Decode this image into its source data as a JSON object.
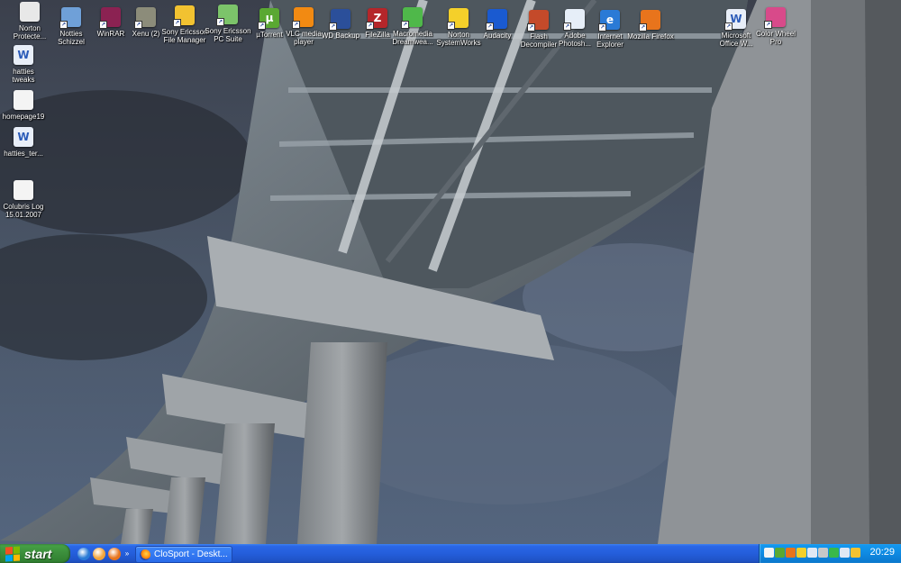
{
  "desktop": {
    "icons": [
      {
        "id": "norton-protected",
        "label": "Norton\nProtecte...",
        "glyph": "",
        "color": "#e8e8e8",
        "shortcut": false
      },
      {
        "id": "notties-schizzel",
        "label": "Notties\nSchizzel",
        "glyph": "",
        "color": "#6fa0d8",
        "shortcut": true
      },
      {
        "id": "winrar",
        "label": "WinRAR",
        "glyph": "",
        "color": "#8b2252",
        "shortcut": true
      },
      {
        "id": "xenu",
        "label": "Xenu (2)",
        "glyph": "",
        "color": "#8c8c7a",
        "shortcut": true
      },
      {
        "id": "sony-ericsson-file-manager",
        "label": "Sony Ericsson\nFile Manager",
        "glyph": "",
        "color": "#f2c231",
        "shortcut": true
      },
      {
        "id": "sony-ericsson-pc-suite",
        "label": "Sony Ericsson\nPC Suite",
        "glyph": "",
        "color": "#7cc46a",
        "shortcut": true
      },
      {
        "id": "utorrent",
        "label": "µTorrent",
        "glyph": "µ",
        "color": "#5aa832",
        "shortcut": true
      },
      {
        "id": "vlc",
        "label": "VLC media\nplayer",
        "glyph": "",
        "color": "#f28a12",
        "shortcut": true
      },
      {
        "id": "wd-backup",
        "label": "WD Backup",
        "glyph": "",
        "color": "#2b4f9a",
        "shortcut": true
      },
      {
        "id": "filezilla",
        "label": "FileZilla",
        "glyph": "Z",
        "color": "#b5262a",
        "shortcut": true
      },
      {
        "id": "dreamweaver",
        "label": "Macromedia\nDreamwea...",
        "glyph": "",
        "color": "#4fb84a",
        "shortcut": true
      },
      {
        "id": "norton-systemworks",
        "label": "Norton\nSystemWorks",
        "glyph": "",
        "color": "#f4d02a",
        "shortcut": true
      },
      {
        "id": "audacity",
        "label": "Audacity",
        "glyph": "",
        "color": "#1a5ad0",
        "shortcut": true
      },
      {
        "id": "flash-decompiler",
        "label": "Flash\nDecompiler",
        "glyph": "",
        "color": "#c44a2a",
        "shortcut": true
      },
      {
        "id": "adobe-photoshop",
        "label": "Adobe\nPhotosh...",
        "glyph": "",
        "color": "#e6eef8",
        "shortcut": true
      },
      {
        "id": "internet-explorer",
        "label": "Internet\nExplorer",
        "glyph": "e",
        "color": "#2a7ad6",
        "shortcut": true
      },
      {
        "id": "mozilla-firefox",
        "label": "Mozilla Firefox",
        "glyph": "",
        "color": "#e8741c",
        "shortcut": true
      },
      {
        "id": "microsoft-office-word",
        "label": "Microsoft\nOffice W...",
        "glyph": "W",
        "color": "#e8eef8",
        "shortcut": true
      },
      {
        "id": "color-wheel-pro",
        "label": "Color Wheel\nPro",
        "glyph": "",
        "color": "#d84a8a",
        "shortcut": true
      },
      {
        "id": "hatties-tweaks",
        "label": "hatties\ntweaks",
        "glyph": "W",
        "color": "#e8eef8",
        "shortcut": false
      },
      {
        "id": "homepage19",
        "label": "homepage19",
        "glyph": "",
        "color": "#f4f4f4",
        "shortcut": false
      },
      {
        "id": "hatties-ter",
        "label": "hatties_ter...",
        "glyph": "W",
        "color": "#e8eef8",
        "shortcut": false
      },
      {
        "id": "colubris-log",
        "label": "Colubris Log\n15.01.2007",
        "glyph": "",
        "color": "#f4f4f4",
        "shortcut": false
      }
    ]
  },
  "taskbar": {
    "start_label": "start",
    "quick_launch": [
      {
        "id": "ql-ie",
        "color": "#2a7ad6"
      },
      {
        "id": "ql-desktop",
        "color": "#f2a43a"
      },
      {
        "id": "ql-firefox",
        "color": "#e8741c"
      }
    ],
    "quick_launch_more": "»",
    "task_button_label": "CloSport - Deskt...",
    "tray_icons": [
      {
        "id": "tray-icon-1",
        "color": "#f4f4f4"
      },
      {
        "id": "tray-icon-2",
        "color": "#5aa832"
      },
      {
        "id": "tray-icon-3",
        "color": "#e8741c"
      },
      {
        "id": "tray-icon-4",
        "color": "#f4d02a"
      },
      {
        "id": "tray-icon-5",
        "color": "#dfe8f4"
      },
      {
        "id": "tray-icon-6",
        "color": "#c8c8c8"
      },
      {
        "id": "tray-icon-7",
        "color": "#3ab84a"
      },
      {
        "id": "tray-icon-8",
        "color": "#dfe8f4"
      },
      {
        "id": "tray-icon-9",
        "color": "#f2c231"
      }
    ],
    "clock": "20:29"
  }
}
